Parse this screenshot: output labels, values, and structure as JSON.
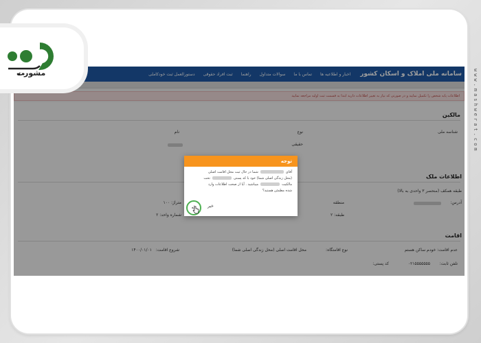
{
  "brand": {
    "logo_text": "مشورت"
  },
  "watermark": "www.mashwerat.com",
  "navbar": {
    "title": "سامانه ملی املاک و اسکان کشور",
    "items": [
      "اخبار و اطلاعیه ها",
      "تماس با ما",
      "سوالات متداول",
      "راهنما",
      "ثبت افراد حقوقی",
      "دستورالعمل ثبت خودکاملی"
    ]
  },
  "alert": {
    "text": "اطلاعات پایه شخص را تکمیل نمایید و در صورتی که نیاز به تغییر اطلاعات دارید ابتدا به قسمت ثبت اولیه مراجعه نمایید"
  },
  "sections": {
    "owner_header": "مالکین",
    "col_national": "شناسه ملی",
    "col_type": "نوع",
    "col_name": "نام",
    "owner_type_value": "حقیقی",
    "property_header": "اطلاعات ملک",
    "floor_label": "طبقه همکف (منحصر ۳ واحدی به بالا)",
    "address_label": "آدرس:",
    "area_label": "متراژ: ۱۰۰",
    "region_label": "منطقه",
    "floor_no_label": "طبقه: ۲",
    "unit_label": "شماره واحد: ۲",
    "residence_header": "اقامت",
    "residence_value": "عدم اقامت: خودم ساکن هستم",
    "place_type_label": "نوع اقامتگاه:",
    "place_type_value": "محل اقامت اصلی (محل زندگی اصلی شما)",
    "start_label": "شروع اقامت:",
    "start_value": "۱۴۰۰/۰۱/۰۱",
    "postal_label": "کد پستی:",
    "phone_label": "تلفن ثابت:",
    "phone_value": "۰۲۱۵۵۵۵۵۵۵"
  },
  "modal": {
    "title": "توجه",
    "line1_a": "آقای",
    "line1_b": "شما در حال ثبت محل اقامت اصلی",
    "line2": "(محل زندگی اصلی شما) خود با کد پستی",
    "line2_b": "تحت",
    "line3_a": "مالکیت",
    "line3_b": "میباشید . آیا از صحت اطلاعات وارد",
    "line4": "شده مطمئن هستید؟",
    "yes_label": "بله",
    "no_label": "خیر"
  },
  "colors": {
    "nav": "#1f5aa6",
    "modal_header": "#f7941d",
    "highlight": "#4caf50",
    "alert_text": "#b94a48"
  }
}
